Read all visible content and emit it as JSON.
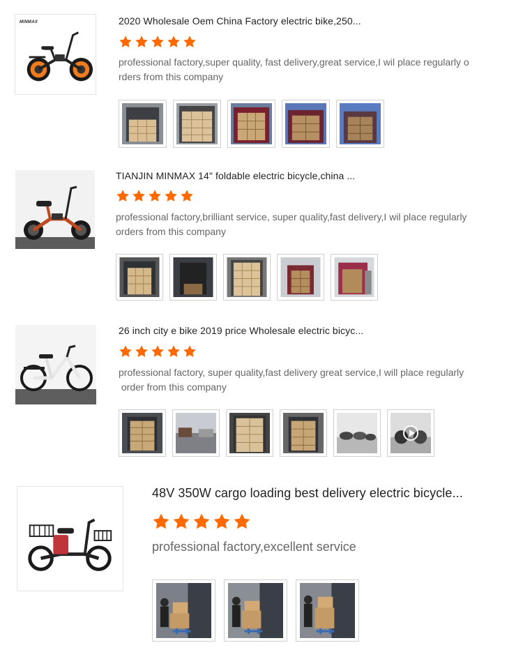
{
  "colors": {
    "star": "#ff6a00",
    "text": "#222222",
    "muted": "#666666"
  },
  "reviews": [
    {
      "title": "2020 Wholesale Oem China Factory electric bike,250...",
      "rating": 5,
      "comment_line1": "professional factory,super quality, fast delivery,great service,I wil place regularly o",
      "comment_line2": "rders from this company",
      "product_logo": "MINMAX",
      "photos": [
        "container-photo",
        "container-photo",
        "container-photo",
        "container-photo",
        "container-photo"
      ]
    },
    {
      "title": "TIANJIN MINMAX 14\" foldable electric bicycle,china ...",
      "rating": 5,
      "comment_line1": "professional factory,brilliant service, super quality,fast delivery,I wil place regularly",
      "comment_line2": "orders from this company",
      "photos": [
        "container-photo",
        "container-photo",
        "container-photo",
        "container-photo",
        "container-photo"
      ]
    },
    {
      "title": "26 inch city e bike 2019 price Wholesale electric bicyc...",
      "rating": 5,
      "comment_line1": "professional factory, super quality,fast delivery great service,I will place regularly",
      "comment_line2": " order from this company",
      "photos": [
        "container-photo",
        "warehouse-photo",
        "container-photo",
        "container-photo",
        "boxes-photo",
        "video-photo"
      ]
    },
    {
      "title": "48V 350W cargo loading best delivery electric bicycle...",
      "rating": 5,
      "comment_line1": "professional factory,excellent service",
      "photos": [
        "loading-photo",
        "loading-photo",
        "loading-photo"
      ]
    }
  ]
}
